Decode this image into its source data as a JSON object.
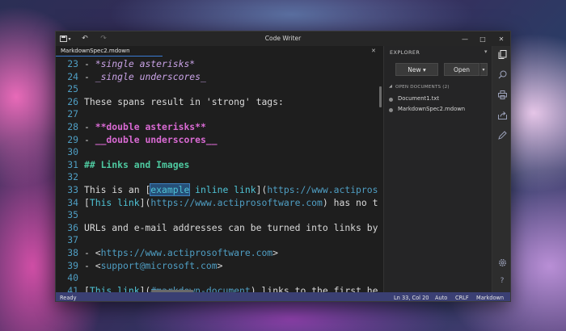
{
  "window": {
    "title": "Code Writer",
    "caption": {
      "minimize": "—",
      "maximize": "□",
      "close": "✕"
    },
    "quick_access": {
      "file_menu": "▾",
      "undo": "↶",
      "redo": "↷"
    }
  },
  "editor_tab": {
    "label": "MarkdownSpec2.mdown",
    "close": "✕",
    "pin": "▾"
  },
  "editor": {
    "lines": [
      {
        "num": "23",
        "segments": [
          {
            "t": "- ",
            "c": "c-bullet"
          },
          {
            "t": "*single asterisks*",
            "c": "c-em"
          }
        ]
      },
      {
        "num": "24",
        "segments": [
          {
            "t": "- ",
            "c": "c-bullet"
          },
          {
            "t": "_single underscores_",
            "c": "c-em"
          }
        ]
      },
      {
        "num": "25",
        "segments": []
      },
      {
        "num": "26",
        "segments": [
          {
            "t": "These spans result in 'strong' tags:",
            "c": ""
          }
        ]
      },
      {
        "num": "27",
        "segments": []
      },
      {
        "num": "28",
        "segments": [
          {
            "t": "- ",
            "c": "c-bullet"
          },
          {
            "t": "**double asterisks**",
            "c": "c-strong"
          }
        ]
      },
      {
        "num": "29",
        "segments": [
          {
            "t": "- ",
            "c": "c-bullet"
          },
          {
            "t": "__double underscores__",
            "c": "c-strong"
          }
        ]
      },
      {
        "num": "30",
        "segments": []
      },
      {
        "num": "31",
        "segments": [
          {
            "t": "## Links and Images",
            "c": "c-heading"
          }
        ]
      },
      {
        "num": "32",
        "segments": []
      },
      {
        "num": "33",
        "segments": [
          {
            "t": "This is an ",
            "c": ""
          },
          {
            "t": "[",
            "c": "c-bracket"
          },
          {
            "t": "example",
            "c": "c-linktext c-sel"
          },
          {
            "t": " inline link",
            "c": "c-linktext"
          },
          {
            "t": "](",
            "c": "c-bracket"
          },
          {
            "t": "https://www.actipros",
            "c": "c-url"
          }
        ]
      },
      {
        "num": "34",
        "segments": [
          {
            "t": "[",
            "c": "c-bracket"
          },
          {
            "t": "This link",
            "c": "c-linktext"
          },
          {
            "t": "](",
            "c": "c-bracket"
          },
          {
            "t": "https://www.actiprosoftware.com",
            "c": "c-url"
          },
          {
            "t": ") has no t",
            "c": ""
          }
        ]
      },
      {
        "num": "35",
        "segments": []
      },
      {
        "num": "36",
        "segments": [
          {
            "t": "URLs and e-mail addresses can be turned into links by",
            "c": ""
          }
        ]
      },
      {
        "num": "37",
        "segments": []
      },
      {
        "num": "38",
        "segments": [
          {
            "t": "- <",
            "c": "c-bullet"
          },
          {
            "t": "https://www.actiprosoftware.com",
            "c": "c-url"
          },
          {
            "t": ">",
            "c": "c-bullet"
          }
        ]
      },
      {
        "num": "39",
        "segments": [
          {
            "t": "- <",
            "c": "c-bullet"
          },
          {
            "t": "support@microsoft.com",
            "c": "c-url"
          },
          {
            "t": ">",
            "c": "c-bullet"
          }
        ]
      },
      {
        "num": "40",
        "segments": []
      },
      {
        "num": "41",
        "segments": [
          {
            "t": "[",
            "c": "c-bracket"
          },
          {
            "t": "This link",
            "c": "c-linktext"
          },
          {
            "t": "](",
            "c": "c-bracket"
          },
          {
            "t": "#markdown-document",
            "c": "c-url"
          },
          {
            "t": ") links to the first he",
            "c": ""
          }
        ]
      }
    ]
  },
  "explorer": {
    "title": "EXPLORER",
    "pin": "▾",
    "new_label": "New ▾",
    "open_label": "Open",
    "open_split": "▾",
    "section_chevron": "◢",
    "section_label": "OPEN DOCUMENTS (2)",
    "documents": [
      "Document1.txt",
      "MarkdownSpec2.mdown"
    ]
  },
  "toolbar": {
    "icons": [
      "documents-icon",
      "search-icon",
      "print-icon",
      "share-icon",
      "pen-icon",
      "settings-icon",
      "help-icon"
    ]
  },
  "status": {
    "ready": "Ready",
    "position": "Ln 33, Col 20",
    "indent": "Auto",
    "eol": "CRLF",
    "language": "Markdown"
  }
}
